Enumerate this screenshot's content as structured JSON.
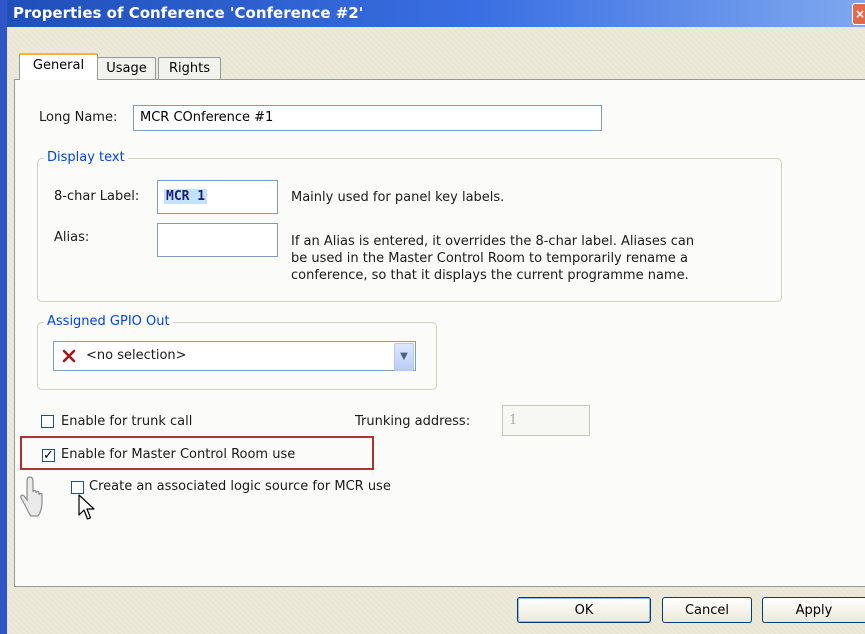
{
  "window": {
    "title": "Properties of Conference 'Conference #2'",
    "close_glyph": "×"
  },
  "tabs": [
    "General",
    "Usage",
    "Rights"
  ],
  "general": {
    "long_name_label": "Long Name:",
    "long_name_value": "MCR COnference #1",
    "display_text": {
      "legend": "Display text",
      "label_label": "8-char Label:",
      "label_value": "MCR 1",
      "label_help": "Mainly used for panel key labels.",
      "alias_label": "Alias:",
      "alias_value": "",
      "alias_help_lines": [
        "If an Alias is entered, it overrides the 8-char label. Aliases can",
        "be used in the Master Control Room to temporarily rename a",
        "conference, so that it displays the current programme name."
      ]
    },
    "gpio": {
      "legend": "Assigned GPIO Out",
      "selected": "<no selection>"
    },
    "trunk": {
      "checkbox_label": "Enable for trunk call",
      "checked": false,
      "address_label": "Trunking address:",
      "address_value": "1"
    },
    "mcr": {
      "checkbox_label": "Enable for Master Control Room use",
      "checked": true,
      "check_glyph": "✓"
    },
    "logic_source": {
      "checkbox_label": "Create an associated logic source for MCR use",
      "checked": false
    }
  },
  "buttons": {
    "ok": "OK",
    "cancel": "Cancel",
    "apply": "Apply"
  },
  "colors": {
    "title_bar": "#1f4fb8",
    "highlight": "#b2312d",
    "legend_text": "#0046d5",
    "select_x": "#a41818"
  },
  "icons": [
    "close-icon",
    "red-x-icon",
    "chevron-down-icon",
    "hand-pointer-icon",
    "arrow-cursor-icon"
  ]
}
